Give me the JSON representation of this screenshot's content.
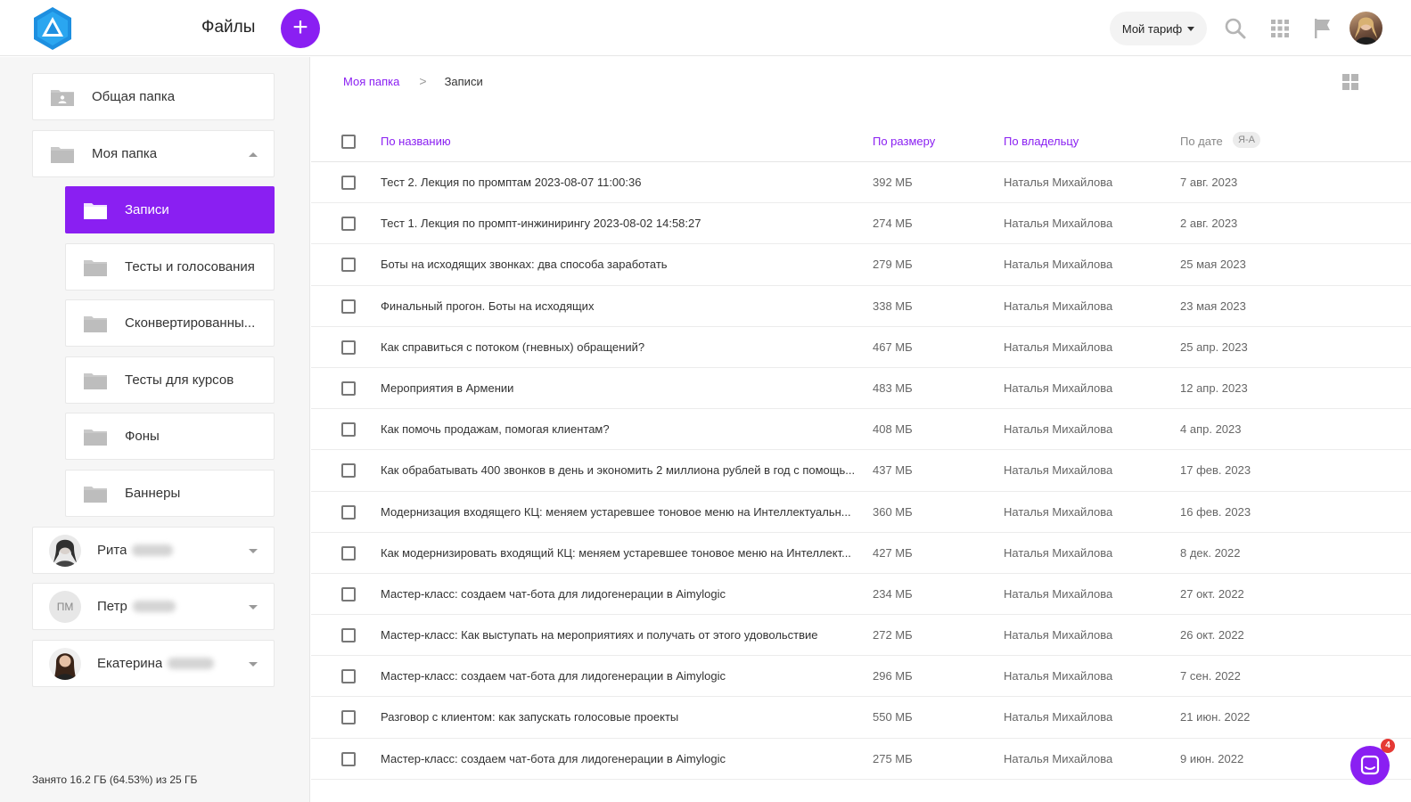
{
  "header": {
    "title": "Файлы",
    "add_label": "+",
    "plan_label": "Мой тариф",
    "icons": [
      "search-icon",
      "apps-grid-icon",
      "flag-icon"
    ]
  },
  "sidebar": {
    "shared": {
      "label": "Общая папка"
    },
    "my_folder": {
      "label": "Моя папка"
    },
    "subfolders": [
      {
        "label": "Записи",
        "active": true
      },
      {
        "label": "Тесты и голосования"
      },
      {
        "label": "Сконвертированны..."
      },
      {
        "label": "Тесты для курсов"
      },
      {
        "label": "Фоны"
      },
      {
        "label": "Баннеры"
      }
    ],
    "users": [
      {
        "first_name": "Рита"
      },
      {
        "first_name": "Петр",
        "initials": "ПМ"
      },
      {
        "first_name": "Екатерина"
      }
    ],
    "storage": "Занято 16.2 ГБ (64.53%) из 25 ГБ"
  },
  "breadcrumb": {
    "root": "Моя папка",
    "sep": ">",
    "current": "Записи"
  },
  "table": {
    "headers": {
      "name": "По названию",
      "size": "По размеру",
      "owner": "По владельцу",
      "date": "По дате",
      "sort": "Я-А"
    },
    "rows": [
      {
        "name": "Тест 2. Лекция по промптам 2023-08-07 11:00:36",
        "size": "392 МБ",
        "owner": "Наталья Михайлова",
        "date": "7 авг. 2023"
      },
      {
        "name": "Тест 1. Лекция по промпт-инжинирингу 2023-08-02 14:58:27",
        "size": "274 МБ",
        "owner": "Наталья Михайлова",
        "date": "2 авг. 2023"
      },
      {
        "name": "Боты на исходящих звонках: два способа заработать",
        "size": "279 МБ",
        "owner": "Наталья Михайлова",
        "date": "25 мая 2023"
      },
      {
        "name": "Финальный прогон. Боты на исходящих",
        "size": "338 МБ",
        "owner": "Наталья Михайлова",
        "date": "23 мая 2023"
      },
      {
        "name": "Как справиться с потоком (гневных) обращений?",
        "size": "467 МБ",
        "owner": "Наталья Михайлова",
        "date": "25 апр. 2023"
      },
      {
        "name": "Мероприятия в Армении",
        "size": "483 МБ",
        "owner": "Наталья Михайлова",
        "date": "12 апр. 2023"
      },
      {
        "name": "Как помочь продажам, помогая клиентам?",
        "size": "408 МБ",
        "owner": "Наталья Михайлова",
        "date": "4 апр. 2023"
      },
      {
        "name": "Как обрабатывать 400 звонков в день и экономить 2 миллиона рублей в год с помощь...",
        "size": "437 МБ",
        "owner": "Наталья Михайлова",
        "date": "17 фев. 2023"
      },
      {
        "name": "Модернизация входящего КЦ: меняем устаревшее тоновое меню на Интеллектуальн...",
        "size": "360 МБ",
        "owner": "Наталья Михайлова",
        "date": "16 фев. 2023"
      },
      {
        "name": "Как модернизировать входящий КЦ: меняем устаревшее тоновое меню на Интеллект...",
        "size": "427 МБ",
        "owner": "Наталья Михайлова",
        "date": "8 дек. 2022"
      },
      {
        "name": "Мастер-класс: создаем чат-бота для лидогенерации в Aimylogic",
        "size": "234 МБ",
        "owner": "Наталья Михайлова",
        "date": "27 окт. 2022"
      },
      {
        "name": "Мастер-класс: Как выступать на мероприятиях и получать от этого удовольствие",
        "size": "272 МБ",
        "owner": "Наталья Михайлова",
        "date": "26 окт. 2022"
      },
      {
        "name": "Мастер-класс: создаем чат-бота для лидогенерации в Aimylogic",
        "size": "296 МБ",
        "owner": "Наталья Михайлова",
        "date": "7 сен. 2022"
      },
      {
        "name": "Разговор с клиентом: как запускать голосовые проекты",
        "size": "550 МБ",
        "owner": "Наталья Михайлова",
        "date": "21 июн. 2022"
      },
      {
        "name": "Мастер-класс: создаем чат-бота для лидогенерации в Aimylogic",
        "size": "275 МБ",
        "owner": "Наталья Михайлова",
        "date": "9 июн. 2022"
      }
    ]
  },
  "chat": {
    "badge": "4"
  },
  "colors": {
    "accent": "#8a1ff2",
    "folder_gray": "#c9c9c9"
  }
}
